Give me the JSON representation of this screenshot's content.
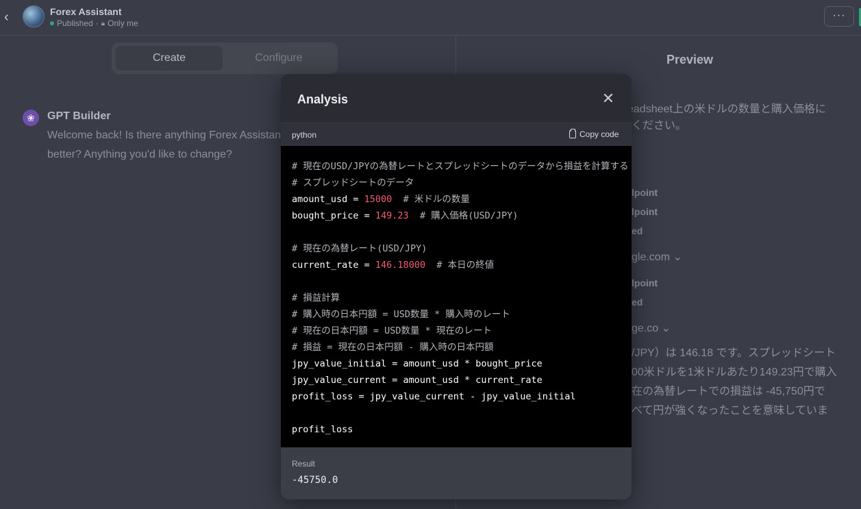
{
  "header": {
    "back_icon": "chevron-left-icon",
    "title": "Forex Assistant",
    "status_published": "Published",
    "status_separator": "·",
    "status_visibility": "Only me",
    "more_label": "···"
  },
  "tabs": [
    {
      "label": "Create",
      "active": true
    },
    {
      "label": "Configure",
      "active": false
    }
  ],
  "builder": {
    "name": "GPT Builder",
    "message": "Welcome back! Is there anything Forex Assistant better? Anything you'd like to change?"
  },
  "preview": {
    "title": "Preview",
    "line1": "eadsheet上の米ドルの数量と購入価格に",
    "line2": "ください。",
    "action1": "lpoint",
    "action2": "lpoint",
    "action3": "ed",
    "domain1": "gle.com",
    "action4": "lpoint",
    "action5": "ed",
    "domain2": "ge.co",
    "answer1": "/JPY）は 146.18 です。スプレッドシート",
    "answer2": "00米ドルを1米ドルあたり149.23円で購入",
    "answer3": "在の為替レートでの損益は -45,750円で",
    "answer4": "べて円が強くなったことを意味していま"
  },
  "modal": {
    "title": "Analysis",
    "close_icon": "close-icon",
    "language": "python",
    "copy_label": "Copy code",
    "code_lines": [
      [
        {
          "t": "# 現在のUSD/JPYの為替レートとスプレッドシートのデータから損益を計算する",
          "c": "com"
        }
      ],
      [
        {
          "t": "# スプレッドシートのデータ",
          "c": "com"
        }
      ],
      [
        {
          "t": "amount_usd = ",
          "c": ""
        },
        {
          "t": "15000",
          "c": "num"
        },
        {
          "t": "  # 米ドルの数量",
          "c": "com"
        }
      ],
      [
        {
          "t": "bought_price = ",
          "c": ""
        },
        {
          "t": "149.23",
          "c": "num"
        },
        {
          "t": "  # 購入価格(USD/JPY)",
          "c": "com"
        }
      ],
      [],
      [
        {
          "t": "# 現在の為替レート(USD/JPY)",
          "c": "com"
        }
      ],
      [
        {
          "t": "current_rate = ",
          "c": ""
        },
        {
          "t": "146.18000",
          "c": "num"
        },
        {
          "t": "  # 本日の終値",
          "c": "com"
        }
      ],
      [],
      [
        {
          "t": "# 損益計算",
          "c": "com"
        }
      ],
      [
        {
          "t": "# 購入時の日本円額 = USD数量 * 購入時のレート",
          "c": "com"
        }
      ],
      [
        {
          "t": "# 現在の日本円額 = USD数量 * 現在のレート",
          "c": "com"
        }
      ],
      [
        {
          "t": "# 損益 = 現在の日本円額 - 購入時の日本円額",
          "c": "com"
        }
      ],
      [
        {
          "t": "jpy_value_initial = amount_usd * bought_price",
          "c": ""
        }
      ],
      [
        {
          "t": "jpy_value_current = amount_usd * current_rate",
          "c": ""
        }
      ],
      [
        {
          "t": "profit_loss = jpy_value_current - jpy_value_initial",
          "c": ""
        }
      ],
      [],
      [
        {
          "t": "profit_loss",
          "c": ""
        }
      ]
    ],
    "result_label": "Result",
    "result_value": "-45750.0"
  },
  "colors": {
    "code_number": "#f25d73",
    "code_comment": "#b4b4bb",
    "published_dot": "#2fa37a"
  }
}
